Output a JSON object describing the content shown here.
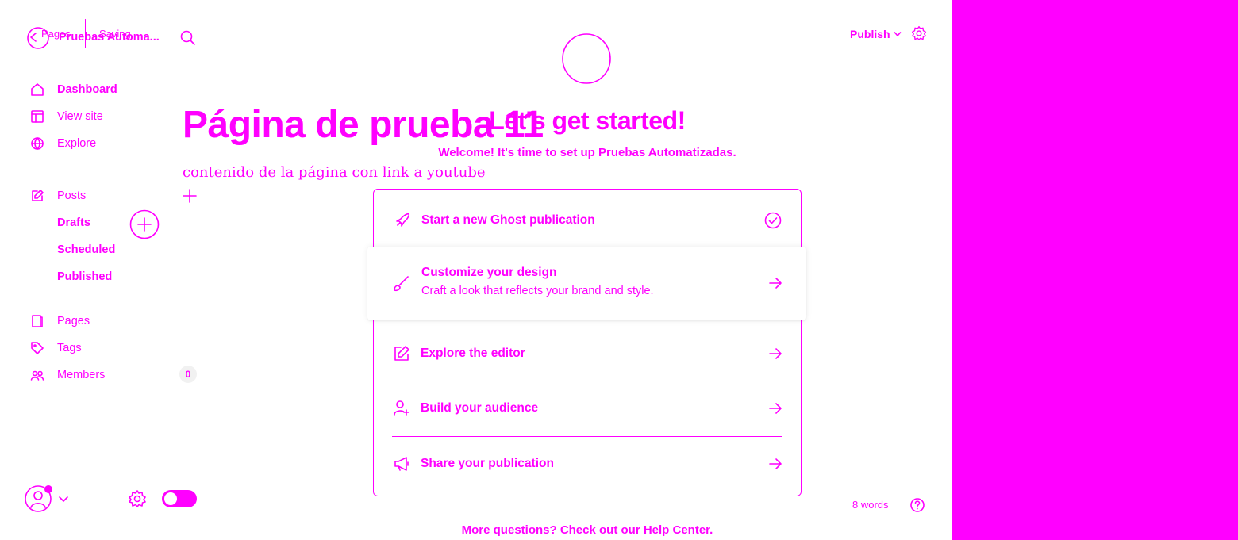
{
  "header": {
    "breadcrumb_pages": "Pages",
    "status": "Saving",
    "site_title": "Pruebas Automa...",
    "publish_label": "Publish"
  },
  "sidebar": {
    "items": [
      {
        "label": "Dashboard",
        "icon": "home-icon"
      },
      {
        "label": "View site",
        "icon": "layout-icon"
      },
      {
        "label": "Explore",
        "icon": "globe-icon"
      },
      {
        "label": "Posts",
        "icon": "edit-icon"
      },
      {
        "label": "Pages",
        "icon": "page-icon"
      },
      {
        "label": "Tags",
        "icon": "tag-icon"
      },
      {
        "label": "Members",
        "icon": "members-icon"
      }
    ],
    "post_subitems": [
      "Drafts",
      "Scheduled",
      "Published"
    ],
    "members_count": "0"
  },
  "editor": {
    "title": "Página de prueba 11",
    "body_text": "contenido de la página con link a youtube",
    "word_count": "8 words"
  },
  "onboarding": {
    "title": "Let's get started!",
    "subtitle": "Welcome! It's time to set up Pruebas Automatizadas.",
    "steps": [
      {
        "title": "Start a new Ghost publication",
        "icon": "rocket-icon",
        "status": "done"
      },
      {
        "title": "Customize your design",
        "description": "Craft a look that reflects your brand and style.",
        "icon": "brush-icon"
      },
      {
        "title": "Explore the editor",
        "icon": "edit-icon"
      },
      {
        "title": "Build your audience",
        "icon": "user-add-icon"
      },
      {
        "title": "Share your publication",
        "icon": "megaphone-icon"
      }
    ],
    "help_text": "More questions? Check out our Help Center."
  },
  "colors": {
    "accent": "#ff00ff",
    "background": "#ffffff"
  }
}
